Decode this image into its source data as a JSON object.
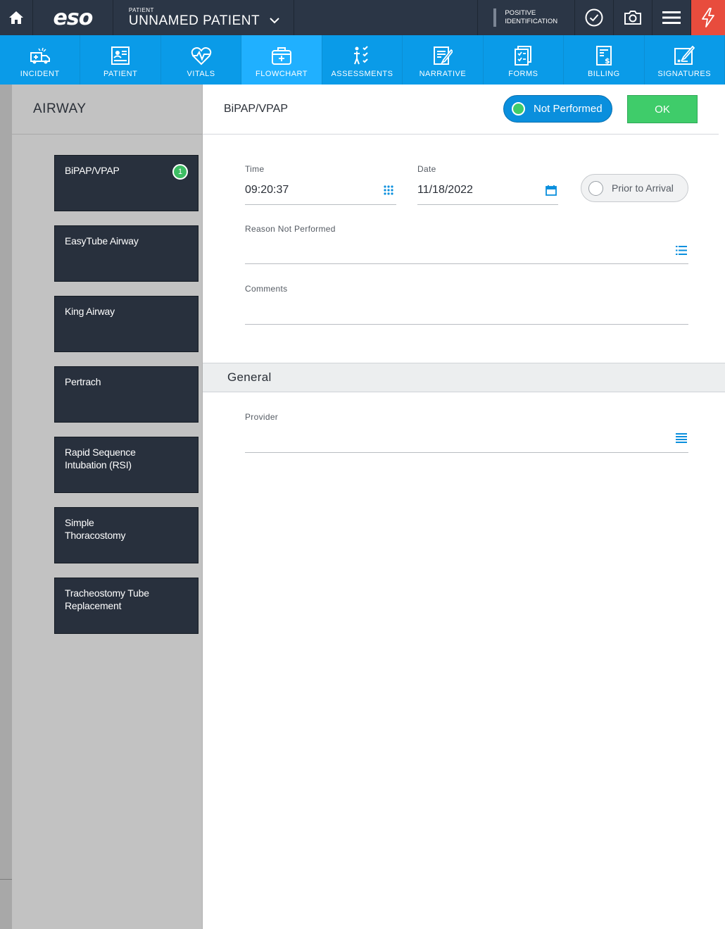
{
  "topbar": {
    "logo": "eso",
    "patient_label": "PATIENT",
    "patient_name": "UNNAMED PATIENT",
    "positive_id_line1": "POSITIVE",
    "positive_id_line2": "IDENTIFICATION",
    "icons": [
      "home-icon",
      "chevron-down-icon",
      "check-circle-icon",
      "camera-icon",
      "menu-icon",
      "flash-icon"
    ],
    "flash_color": "#e84c3d"
  },
  "nav": {
    "items": [
      {
        "label": "INCIDENT",
        "icon": "ambulance-icon"
      },
      {
        "label": "PATIENT",
        "icon": "patient-card-icon"
      },
      {
        "label": "VITALS",
        "icon": "heartbeat-icon"
      },
      {
        "label": "FLOWCHART",
        "icon": "medkit-icon"
      },
      {
        "label": "ASSESSMENTS",
        "icon": "assessment-icon"
      },
      {
        "label": "NARRATIVE",
        "icon": "narrative-icon"
      },
      {
        "label": "FORMS",
        "icon": "forms-icon"
      },
      {
        "label": "BILLING",
        "icon": "billing-icon"
      },
      {
        "label": "SIGNATURES",
        "icon": "signature-icon"
      }
    ],
    "active": "FLOWCHART",
    "color": "#0a9be8",
    "active_color": "#20b0ff"
  },
  "sidebar": {
    "title": "AIRWAY",
    "items": [
      {
        "label": "BiPAP/VPAP",
        "badge": "1"
      },
      {
        "label": "EasyTube Airway"
      },
      {
        "label": "King Airway"
      },
      {
        "label": "Pertrach"
      },
      {
        "label": "Rapid Sequence Intubation (RSI)"
      },
      {
        "label": "Simple Thoracostomy"
      },
      {
        "label": "Tracheostomy Tube Replacement"
      }
    ]
  },
  "main": {
    "title": "BiPAP/VPAP",
    "not_performed_label": "Not Performed",
    "ok_label": "OK",
    "time_label": "Time",
    "time_value": "09:20:37",
    "date_label": "Date",
    "date_value": "11/18/2022",
    "prior_to_arrival_label": "Prior to Arrival",
    "reason_label": "Reason Not Performed",
    "reason_value": "",
    "comments_label": "Comments",
    "comments_value": "",
    "general_section": "General",
    "provider_label": "Provider",
    "provider_value": "",
    "accent_green": "#3fcc6a",
    "accent_blue": "#0a8fdd"
  }
}
